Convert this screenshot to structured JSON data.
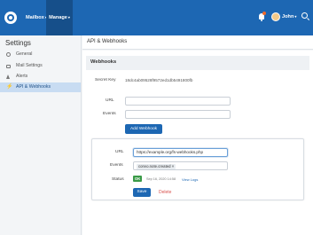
{
  "topbar": {
    "mailbox_label": "Mailbox",
    "manage_label": "Manage",
    "user_name": "John",
    "caret": "▾"
  },
  "sidebar": {
    "title": "Settings",
    "items": [
      {
        "label": "General",
        "icon": "gear-icon"
      },
      {
        "label": "Mail Settings",
        "icon": "mail-icon"
      },
      {
        "label": "Alerts",
        "icon": "alert-icon"
      },
      {
        "label": "API & Webhooks",
        "icon": "bolt-icon",
        "active": true
      }
    ]
  },
  "content": {
    "header": "API & Webhooks",
    "section_title": "Webhooks",
    "secret_key_label": "Secret Key",
    "secret_key_value": "18dc4ab09528f9572ed1db5491800fb",
    "url_label": "URL",
    "url_value": "",
    "events_label": "Events",
    "events_value": "",
    "add_button": "Add Webhook"
  },
  "webhook": {
    "url_label": "URL",
    "url_value": "https://example.org/fs-webhooks.php",
    "events_label": "Events",
    "event_tag": "convo.note.created",
    "event_tag_remove": "×",
    "status_label": "Status",
    "status_badge": "OK",
    "status_time": "Sep 16, 2020 14:58",
    "view_logs": "View Logs",
    "save_button": "Save",
    "delete_button": "Delete"
  },
  "colors": {
    "brand": "#1d67b3",
    "ok": "#3a9a47",
    "danger": "#d9534f"
  }
}
